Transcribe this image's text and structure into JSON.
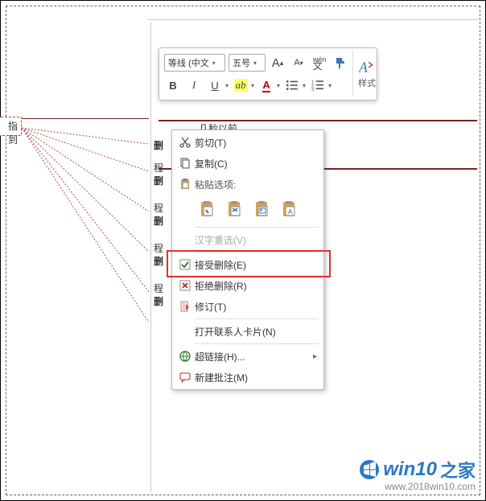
{
  "toolbar": {
    "font_family": "等线 (中文",
    "font_size": "五号",
    "grow_font": "A",
    "shrink_font": "A",
    "phonetic": "文",
    "format_painter_tip": "格式刷",
    "bold": "B",
    "italic": "I",
    "underline": "U",
    "styles_label": "样式"
  },
  "timestamp": "几秒以前",
  "fragment_text": "指到",
  "changes": [
    {
      "line1": "删"
    },
    {
      "line1": "程",
      "line2": "删"
    },
    {
      "line1": "程",
      "line2": "删"
    },
    {
      "line1": "程",
      "line2": "删"
    },
    {
      "line1": "程",
      "line2": "删"
    }
  ],
  "context_menu": {
    "cut": "剪切(T)",
    "copy": "复制(C)",
    "paste_header": "粘贴选项:",
    "reconvert": "汉字重选(V)",
    "accept_delete": "接受删除(E)",
    "reject_delete": "拒绝删除(R)",
    "track_changes": "修订(T)",
    "open_contact": "打开联系人卡片(N)",
    "hyperlink": "超链接(H)...",
    "new_comment": "新建批注(M)"
  },
  "watermark": {
    "brand": "win10",
    "suffix": "之家",
    "url": "www.2018win10.com"
  }
}
